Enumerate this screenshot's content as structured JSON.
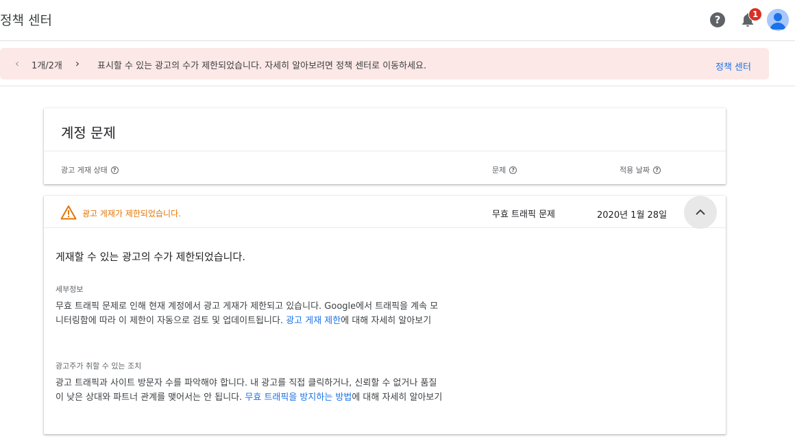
{
  "header": {
    "title": "정책 센터",
    "help_icon": "?",
    "notification_count": "1"
  },
  "banner": {
    "pager": "1개/2개",
    "message": "표시할 수 있는 광고의 수가 제한되었습니다. 자세히 알아보려면 정책 센터로 이동하세요.",
    "link": "정책 센터"
  },
  "summary_card": {
    "title": "계정 문제",
    "columns": [
      "광고 게재 상태",
      "문제",
      "적용 날짜"
    ]
  },
  "issue": {
    "status": "광고 게재가 제한되었습니다.",
    "problem": "무효 트래픽 문제",
    "date": "2020년 1월 28일",
    "heading": "게재할 수 있는 광고의 수가 제한되었습니다.",
    "details_label": "세부정보",
    "details_text": "무효 트래픽 문제로 인해 현재 계정에서 광고 게재가 제한되고 있습니다. Google에서 트래픽을 계속 모니터링함에 따라 이 제한이 자동으로 검토 및 업데이트됩니다. ",
    "details_link": "광고 게재 제한",
    "details_suffix": "에 대해 자세히 알아보기",
    "actions_label": "광고주가 취할 수 있는 조치",
    "actions_text": "광고 트래픽과 사이트 방문자 수를 파악해야 합니다. 내 광고를 직접 클릭하거나, 신뢰할 수 없거나 품질이 낮은 상대와 파트너 관계를 맺어서는 안 됩니다. ",
    "actions_link": "무효 트래픽을 방지하는 방법",
    "actions_suffix": "에 대해 자세히 알아보기"
  },
  "colors": {
    "banner_bg": "#fce8e6",
    "link": "#1a73e8",
    "warning": "#e37400",
    "badge": "#d93025"
  }
}
